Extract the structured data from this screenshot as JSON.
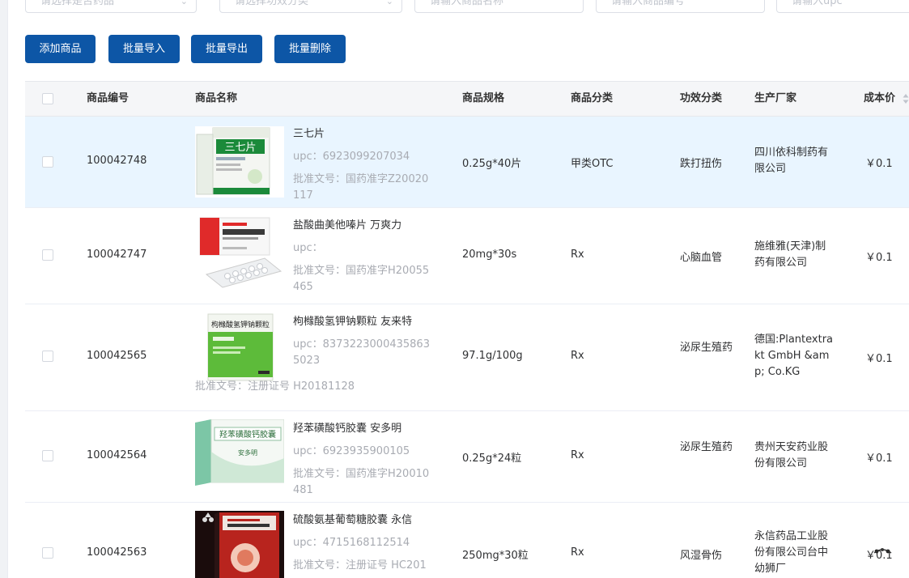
{
  "filters": [
    {
      "placeholder": "请选择是否药品",
      "type": "select"
    },
    {
      "placeholder": "请选择功效分类",
      "type": "select"
    },
    {
      "placeholder": "请输入商品名称",
      "type": "input"
    },
    {
      "placeholder": "请输入商品编号",
      "type": "input"
    },
    {
      "placeholder": "请输入upc",
      "type": "input"
    }
  ],
  "toolbar": {
    "add": "添加商品",
    "import": "批量导入",
    "export": "批量导出",
    "delete": "批量删除",
    "button_color": "#0d56a6"
  },
  "table": {
    "headers": {
      "code": "商品编号",
      "name": "商品名称",
      "spec": "商品规格",
      "category": "商品分类",
      "effect": "功效分类",
      "maker": "生产厂家",
      "cost": "成本价"
    },
    "rows": [
      {
        "code": "100042748",
        "name": "三七片",
        "upc": "upc：6923099207034",
        "approval": "批准文号：国药准字Z20020117",
        "spec": "0.25g*40片",
        "category": "甲类OTC",
        "effect": "跌打扭伤",
        "maker": "四川依科制药有限公司",
        "cost": "￥0.1",
        "highlighted": true,
        "image_icon": "sanqi-box-image"
      },
      {
        "code": "100042747",
        "name": "盐酸曲美他嗪片 万爽力",
        "upc": "upc：",
        "approval": "批准文号：国药准字H20055465",
        "spec": "20mg*30s",
        "category": "Rx",
        "effect": "心脑血管",
        "maker": "施维雅(天津)制药有限公司",
        "cost": "￥0.1",
        "highlighted": false,
        "image_icon": "trimetazidine-box-image"
      },
      {
        "code": "100042565",
        "name": "枸橼酸氢钾钠颗粒 友来特",
        "upc": "upc：83732230004358635023",
        "approval": "批准文号：注册证号 H20181128",
        "spec": "97.1g/100g",
        "category": "Rx",
        "effect": "泌尿生殖药",
        "maker": "德国:Plantextrakt GmbH &amp; Co.KG",
        "cost": "￥0.1",
        "highlighted": false,
        "image_icon": "citrate-granules-box-image"
      },
      {
        "code": "100042564",
        "name": "羟苯磺酸钙胶囊 安多明",
        "upc": "upc：6923935900105",
        "approval": "批准文号：国药准字H20010481",
        "spec": "0.25g*24粒",
        "category": "Rx",
        "effect": "泌尿生殖药",
        "maker": "贵州天安药业股份有限公司",
        "cost": "￥0.1",
        "highlighted": false,
        "image_icon": "dobesilate-box-image"
      },
      {
        "code": "100042563",
        "name": "硫酸氨基葡萄糖胶囊 永信",
        "upc": "upc：4715168112514",
        "approval": "批准文号：注册证号 HC201",
        "spec": "250mg*30粒",
        "category": "Rx",
        "effect": "风湿骨伤",
        "maker": "永信药品工业股份有限公司台中幼狮厂",
        "cost": "￥0.1",
        "highlighted": false,
        "image_icon": "glucosamine-box-image"
      }
    ]
  }
}
